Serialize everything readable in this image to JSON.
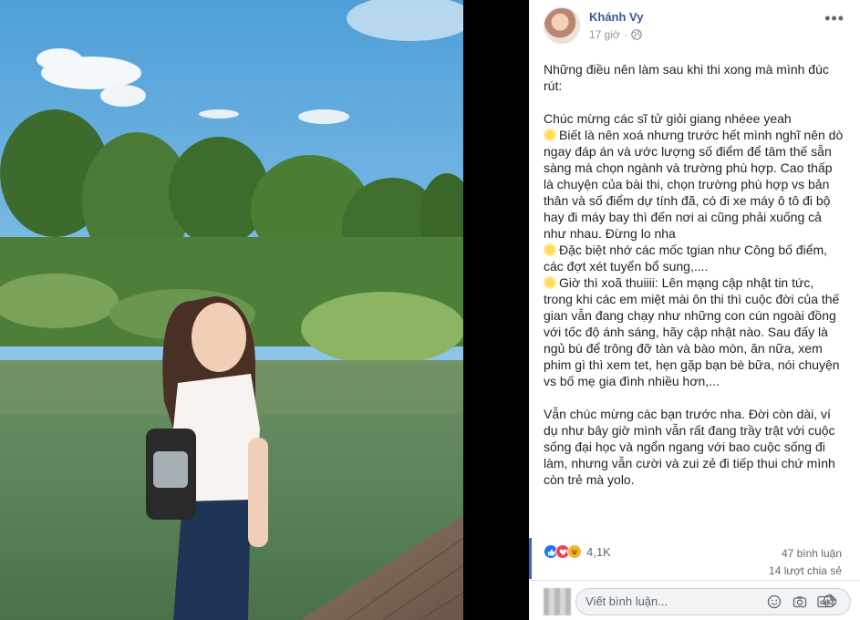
{
  "post": {
    "author": "Khánh Vy",
    "time": "17 giờ",
    "text_lines": [
      "Những điều nên làm sau khi thi xong mà mình đúc rút:"
    ],
    "paragraphs": {
      "intro": "Những điều nên làm sau khi thi xong mà mình đúc rút:",
      "congrats": "Chúc mừng các sĩ tử giỏi giang nhéee yeah",
      "point1": "Biết là nên xoá nhưng trước hết mình nghĩ nên dò ngay đáp án và ước lượng số điểm để tâm thế sẵn sàng mà chọn ngành và trường phù hợp. Cao thấp là chuyện của bài thi, chọn trường phù hợp vs bản thân và số điểm dự tính đã, có đi xe máy ô tô đi bộ hay đi máy bay thì đến nơi ai cũng phải xuống cả như nhau. Đừng lo nha",
      "point2": "Đặc biệt nhớ các mốc tgian như Công bố điểm, các đợt xét tuyển bổ sung,....",
      "point3": "Giờ thì xoã thuiiii: Lên mạng cập nhật tin tức, trong khi các em miệt mài ôn thi thì cuộc đời của thế gian vẫn đang chạy như những con cún ngoài đồng với tốc độ ánh sáng, hãy cập nhật nào. Sau đấy là ngủ bù để trông đỡ tàn và bào mòn, ăn nữa, xem phim gì thì xem tet, hẹn gặp bạn bè bữa, nói chuyện vs bố mẹ gia đình nhiều hơn,...",
      "closing": "Vẫn chúc mừng các bạn trước nha. Đời còn dài, ví dụ như bây giờ mình vẫn rất đang trầy trật với cuộc sống đại học và ngổn ngang với bao cuộc sống đi làm, nhưng vẫn cười và zui zẻ đi tiếp thui chứ mình còn trẻ mà yolo."
    }
  },
  "stats": {
    "reactions": "4,1K",
    "reaction_icons": [
      "like-icon",
      "love-icon",
      "haha-icon"
    ],
    "comments": "47 bình luận",
    "shares": "14 lượt chia sẻ"
  },
  "comment": {
    "placeholder": "Viết bình luận...",
    "icons": [
      "smiley-icon",
      "camera-icon",
      "gif-icon",
      "sticker-icon"
    ]
  },
  "colors": {
    "author": "#385898",
    "accent": "#4267b2"
  }
}
